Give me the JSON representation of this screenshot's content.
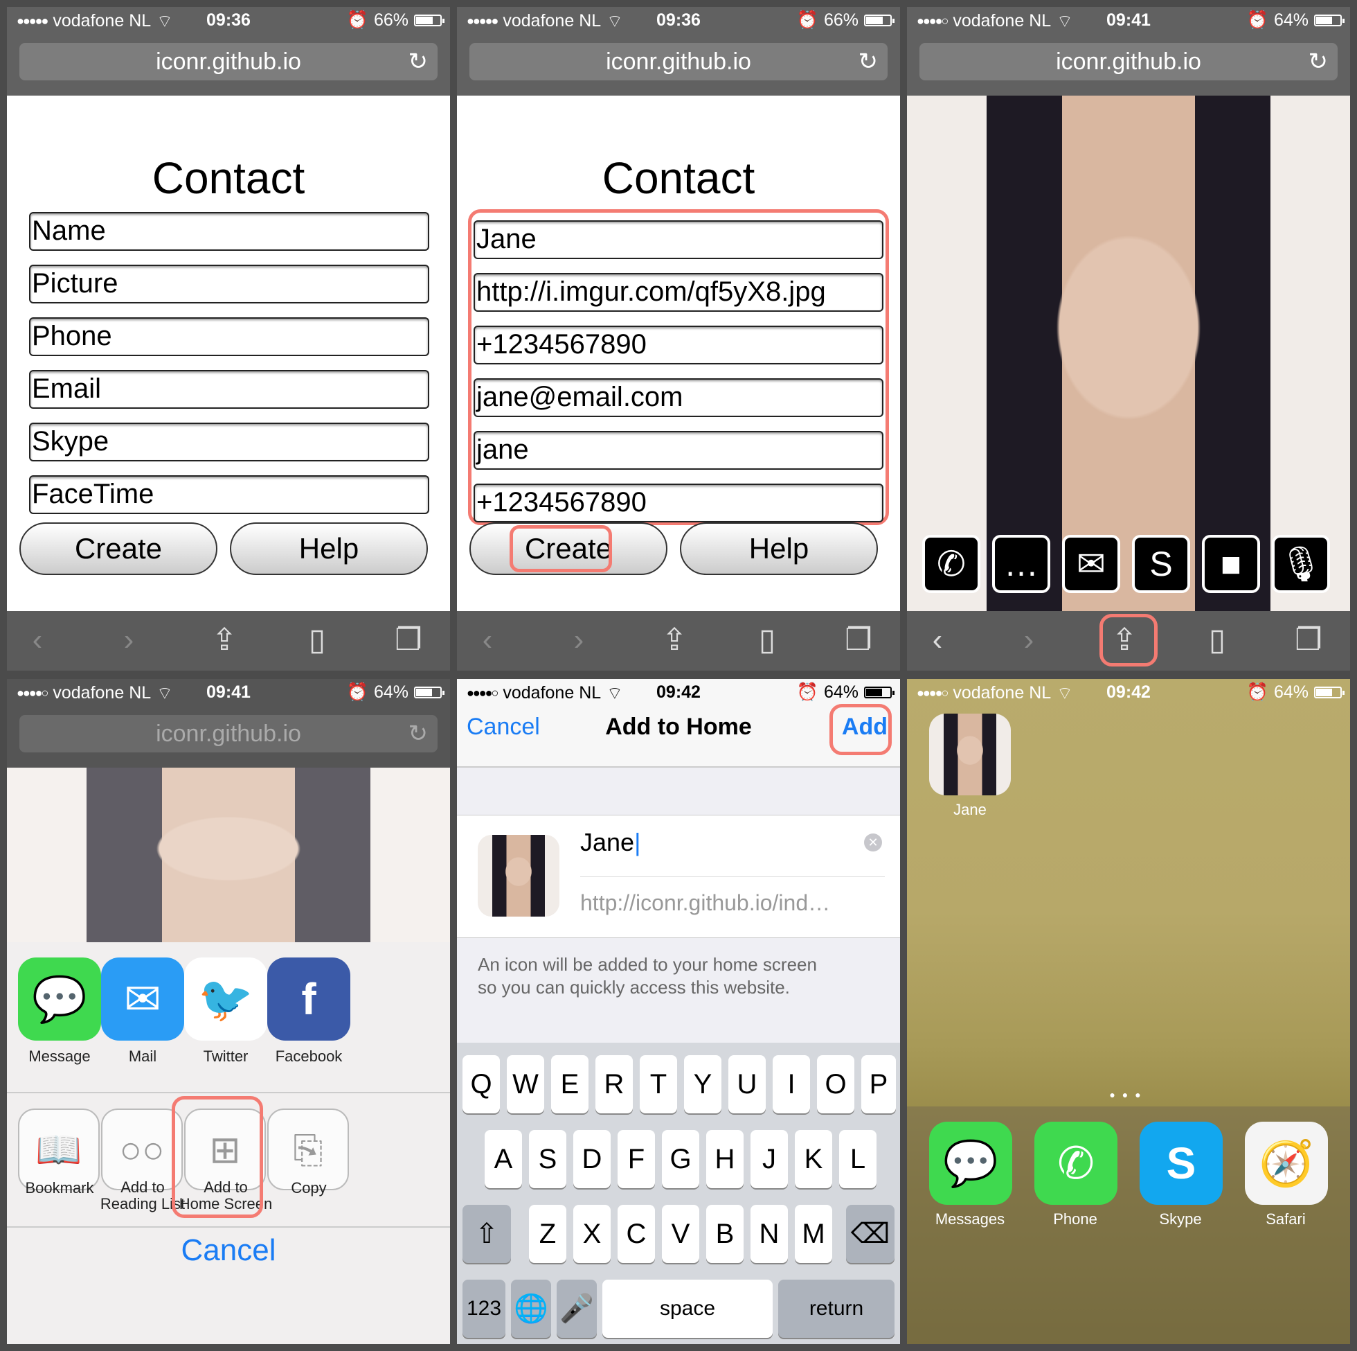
{
  "status": {
    "carrier": "vodafone NL",
    "p1": {
      "time": "09:36",
      "battery": "66%"
    },
    "p2": {
      "time": "09:36",
      "battery": "66%"
    },
    "p3": {
      "time": "09:41",
      "battery": "64%"
    },
    "p4": {
      "time": "09:41",
      "battery": "64%"
    },
    "p5": {
      "time": "09:42",
      "battery": "64%"
    },
    "p6": {
      "time": "09:42",
      "battery": "64%"
    }
  },
  "url": "iconr.github.io",
  "form": {
    "title": "Contact",
    "placeholders": [
      "Name",
      "Picture",
      "Phone",
      "Email",
      "Skype",
      "FaceTime"
    ],
    "values": [
      "Jane",
      "http://i.imgur.com/qf5yX8.jpg",
      "+1234567890",
      "jane@email.com",
      "jane",
      "+1234567890"
    ],
    "create_label": "Create",
    "help_label": "Help"
  },
  "share": {
    "apps": [
      {
        "label": "Message",
        "icon": "message-icon",
        "color": "#3fd94f"
      },
      {
        "label": "Mail",
        "icon": "mail-icon",
        "color": "#2a9cf5"
      },
      {
        "label": "Twitter",
        "icon": "twitter-icon",
        "color": "#2aa4e8"
      },
      {
        "label": "Facebook",
        "icon": "facebook-icon",
        "color": "#3b5aa8"
      }
    ],
    "actions": [
      {
        "label1": "Bookmark",
        "label2": ""
      },
      {
        "label1": "Add to",
        "label2": "Reading List"
      },
      {
        "label1": "Add to",
        "label2": "Home Screen"
      },
      {
        "label1": "Copy",
        "label2": ""
      }
    ],
    "cancel": "Cancel"
  },
  "add_home": {
    "cancel": "Cancel",
    "title": "Add to Home",
    "add": "Add",
    "name": "Jane",
    "url": "http://iconr.github.io/ind…",
    "hint_line1": "An icon will be added to your home screen",
    "hint_line2": "so you can quickly access this website."
  },
  "keyboard": {
    "row1": [
      "Q",
      "W",
      "E",
      "R",
      "T",
      "Y",
      "U",
      "I",
      "O",
      "P"
    ],
    "row2": [
      "A",
      "S",
      "D",
      "F",
      "G",
      "H",
      "J",
      "K",
      "L"
    ],
    "row3": [
      "Z",
      "X",
      "C",
      "V",
      "B",
      "N",
      "M"
    ],
    "numbers": "123",
    "space": "space",
    "return": "return"
  },
  "home": {
    "app_label": "Jane",
    "dock": [
      {
        "label": "Messages",
        "color": "#3fd94f"
      },
      {
        "label": "Phone",
        "color": "#3fd94f"
      },
      {
        "label": "Skype",
        "color": "#12a7ef"
      },
      {
        "label": "Safari",
        "color": "#f4f4f4"
      }
    ]
  },
  "accent": "#f47b72",
  "ios_blue": "#1a7cf4"
}
